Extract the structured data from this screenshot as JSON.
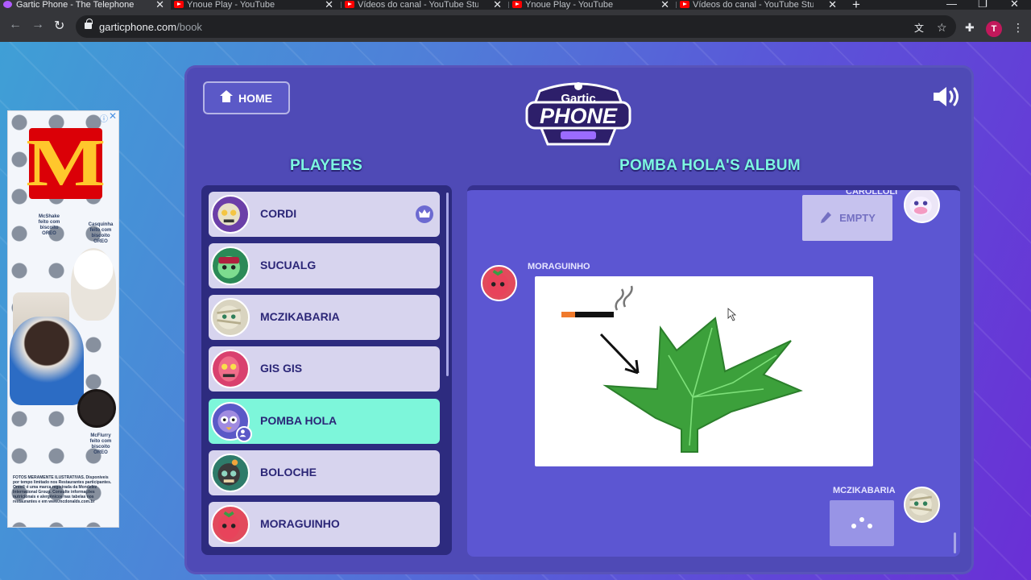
{
  "browser": {
    "tabs": [
      {
        "title": "Gartic Phone - The Telephone Ga",
        "icon": "gartic-icon",
        "active": true
      },
      {
        "title": "Ynoue Play - YouTube",
        "icon": "youtube-icon",
        "active": false
      },
      {
        "title": "Vídeos do canal - YouTube Studio",
        "icon": "youtube-icon",
        "active": false
      },
      {
        "title": "Ynoue Play - YouTube",
        "icon": "youtube-icon",
        "active": false
      },
      {
        "title": "Vídeos do canal - YouTube Studio",
        "icon": "youtube-icon",
        "active": false
      }
    ],
    "url_domain": "garticphone.com",
    "url_path": "/book",
    "profile_initial": "T"
  },
  "ad": {
    "side_text_1": "McShake feito com biscoito OREO",
    "side_text_2": "Casquinha feito com biscoito OREO",
    "side_text_3": "McFlurry feito com biscoito OREO",
    "fine_print": "FOTOS MERAMENTE ILUSTRATIVAS. Disponíveis por tempo limitado nos Restaurantes participantes. Oreo® é uma marca registrada da Mondelez International Group. Consulte informações nutricionais e alergênicos nas tabelas nos restaurantes e em www.mcdonalds.com.br",
    "brand_color": "#db0007"
  },
  "header": {
    "home_label": "HOME",
    "logo_top": "Gartic",
    "logo_bottom": "PHONE",
    "sound_icon": "speaker-icon"
  },
  "players_title": "PLAYERS",
  "players": [
    {
      "name": "CORDI",
      "host": true,
      "active": false,
      "avatar_color": "#6b3fa8"
    },
    {
      "name": "SUCUALG",
      "host": false,
      "active": false,
      "avatar_color": "#2b8a57"
    },
    {
      "name": "MCZIKABARIA",
      "host": false,
      "active": false,
      "avatar_color": "#d9d4c0"
    },
    {
      "name": "GIS GIS",
      "host": false,
      "active": false,
      "avatar_color": "#d9416e"
    },
    {
      "name": "POMBA HOLA",
      "host": false,
      "active": true,
      "avatar_color": "#5b59c7"
    },
    {
      "name": "BOLOCHE",
      "host": false,
      "active": false,
      "avatar_color": "#2e7b6a"
    },
    {
      "name": "MORAGUINHO",
      "host": false,
      "active": false,
      "avatar_color": "#e24a5c"
    }
  ],
  "album": {
    "title": "POMBA HOLA'S ALBUM",
    "entries": [
      {
        "author": "CAROLLOLI",
        "content": "EMPTY"
      },
      {
        "author": "MORAGUINHO",
        "content": "drawing"
      },
      {
        "author": "MCZIKABARIA",
        "content": "loading"
      }
    ]
  }
}
